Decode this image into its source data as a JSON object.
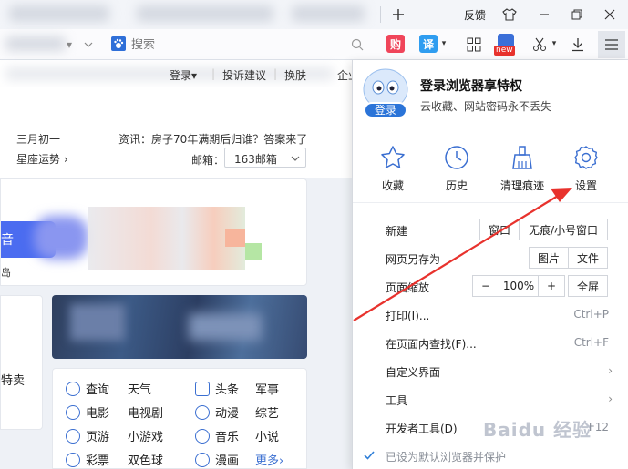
{
  "titlebar": {
    "feedback": "反馈"
  },
  "addressbar": {
    "search_placeholder": "搜索",
    "badge_new": "new"
  },
  "page": {
    "topnav": {
      "login": "登录▾",
      "complaint": "投诉建议",
      "skin": "换肤",
      "partial": "企业"
    },
    "lunar_date": "三月初一",
    "horoscope": "星座运势",
    "news": "资讯：房子70年满期后归谁？答案来了",
    "mail_label": "邮箱：",
    "mail_select": "163邮箱",
    "left_partial_1": "音",
    "left_partial_2": "岛",
    "special_sale": "特卖",
    "quick_links": [
      {
        "a": "查询",
        "b": "天气",
        "c": "头条",
        "d": "军事"
      },
      {
        "a": "电影",
        "b": "电视剧",
        "c": "动漫",
        "d": "综艺"
      },
      {
        "a": "页游",
        "b": "小游戏",
        "c": "音乐",
        "d": "小说"
      },
      {
        "a": "彩票",
        "b": "双色球",
        "c": "漫画",
        "d": "更多›"
      }
    ]
  },
  "menu": {
    "login_title": "登录浏览器享特权",
    "login_subtitle": "云收藏、网站密码永不丢失",
    "login_button": "登录",
    "quick": {
      "favorites": "收藏",
      "history": "历史",
      "clear_traces": "清理痕迹",
      "settings": "设置"
    },
    "new_label": "新建",
    "new_window": "窗口",
    "new_private_window": "无痕/小号窗口",
    "save_as_label": "网页另存为",
    "save_image": "图片",
    "save_file": "文件",
    "zoom_label": "页面缩放",
    "zoom_minus": "−",
    "zoom_value": "100%",
    "zoom_plus": "+",
    "fullscreen": "全屏",
    "print_label": "打印(I)...",
    "print_shortcut": "Ctrl+P",
    "find_label": "在页面内查找(F)...",
    "find_shortcut": "Ctrl+F",
    "customize_label": "自定义界面",
    "tools_label": "工具",
    "devtools_label": "开发者工具(D)",
    "devtools_shortcut": "F12",
    "default_browser": "已设为默认浏览器并保护"
  },
  "watermark": "Baidu 经验",
  "colors": {
    "accent_blue": "#3b6fd1",
    "annotation_red": "#e8322d",
    "check_blue": "#2f7fd8"
  }
}
